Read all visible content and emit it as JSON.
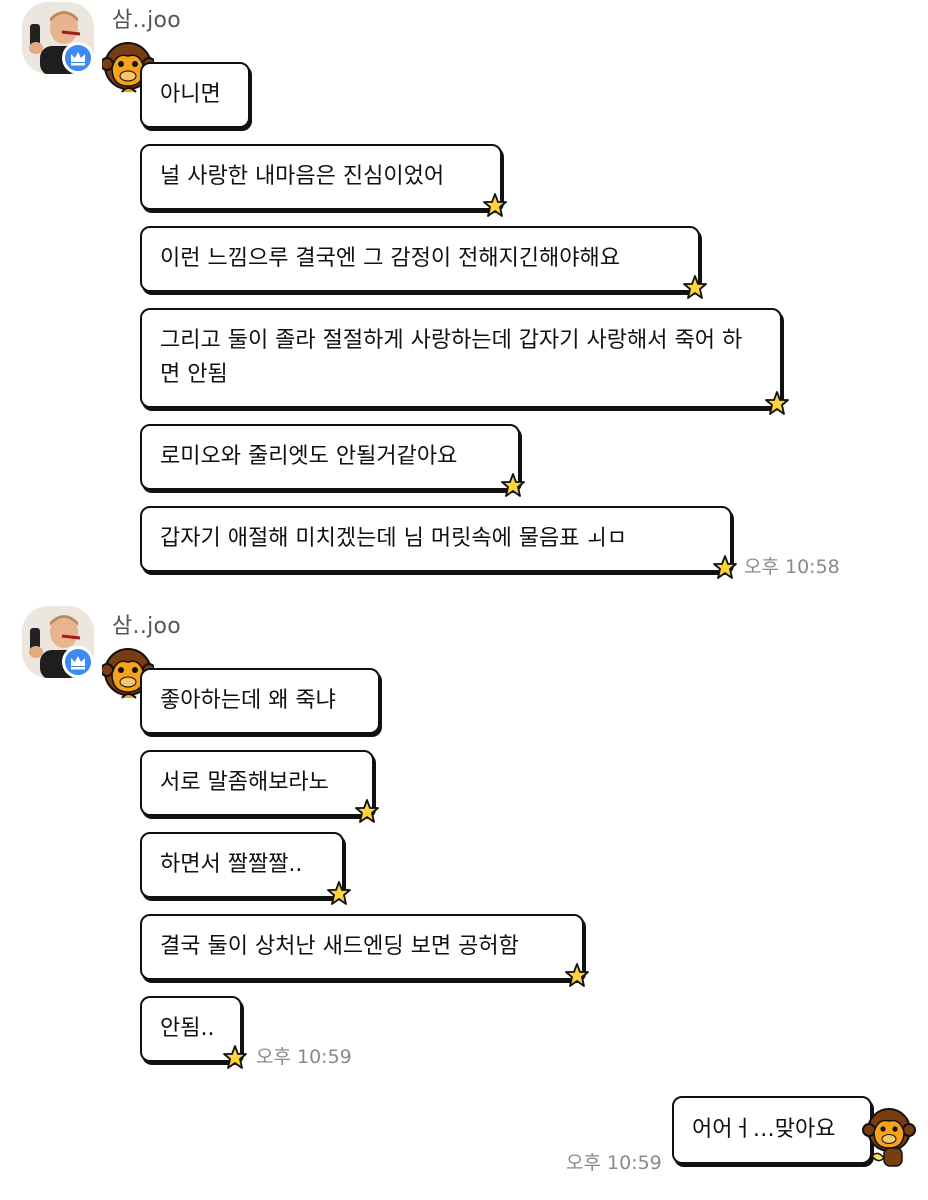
{
  "groups": [
    {
      "sender": "삼..joo",
      "messages": [
        "아니면",
        "널 사랑한 내마음은 진심이었어",
        "이런 느낌으루 결국엔 그 감정이 전해지긴해야해요",
        "그리고 둘이 졸라 절절하게 사랑하는데 갑자기 사랑해서 죽어 하면 안됨",
        "로미오와 줄리엣도 안될거같아요",
        "갑자기 애절해 미치겠는데 님 머릿속에 물음표 ㅚㅁ"
      ],
      "time": "오후 10:58"
    },
    {
      "sender": "삼..joo",
      "messages": [
        "좋아하는데 왜 죽냐",
        "서로 말좀해보라노",
        "하면서 짤짤짤..",
        "결국 둘이 상처난 새드엔딩 보면 공허함",
        "안됨.."
      ],
      "time": "오후 10:59"
    }
  ],
  "my_message": {
    "text": "어어ㅓ…맞아요",
    "time": "오후 10:59"
  },
  "icons": {
    "avatar": "profile-photo",
    "badge": "crown-icon",
    "sticker": "monkey-icon",
    "tail": "star-icon"
  },
  "colors": {
    "badge_blue": "#3d8bf2",
    "star_yellow": "#ffd43b",
    "bubble_border": "#111111",
    "timestamp": "#8a8a8a"
  }
}
